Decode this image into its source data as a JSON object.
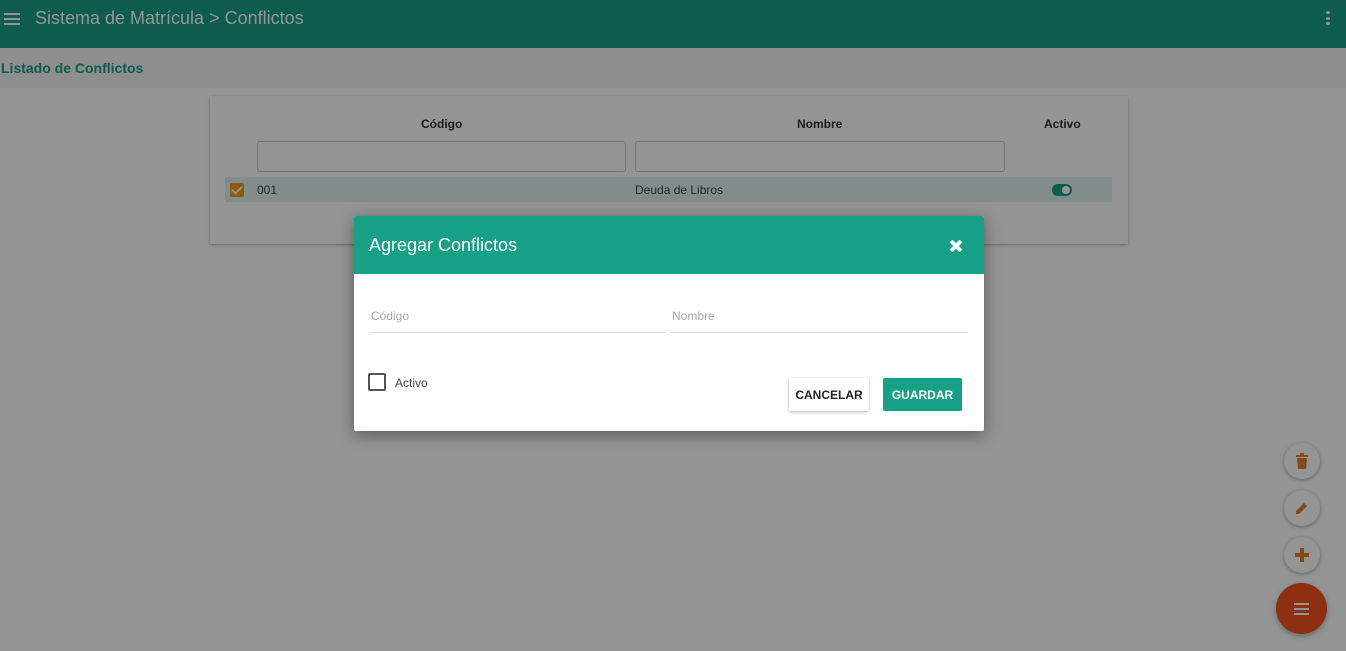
{
  "appbar": {
    "title": "Sistema de Matrícula > Conflictos"
  },
  "page": {
    "subtitle": "Listado de Conflictos"
  },
  "table": {
    "columns": [
      "Código",
      "Nombre",
      "Activo"
    ],
    "rows": [
      {
        "codigo": "001",
        "nombre": "Deuda de Libros",
        "selected": true,
        "activo": true
      }
    ]
  },
  "fabs": {
    "items": [
      "trash-icon",
      "pencil-icon",
      "plus-icon"
    ],
    "main": "menu-icon"
  },
  "dialog": {
    "title": "Agregar Conflictos",
    "codigo_placeholder": "Código",
    "nombre_placeholder": "Nombre",
    "codigo_value": "",
    "nombre_value": "",
    "activo_label": "Activo",
    "activo_checked": false,
    "cancel_label": "CANCELAR",
    "save_label": "GUARDAR"
  },
  "colors": {
    "primary": "#16a085",
    "accent": "#f39c12",
    "fab": "#f4511e"
  }
}
